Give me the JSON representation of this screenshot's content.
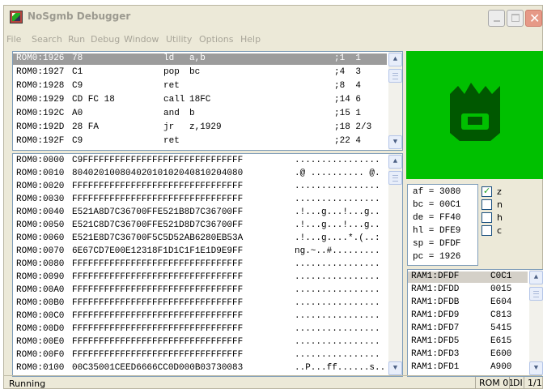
{
  "window": {
    "title": "NoSgmb Debugger"
  },
  "menu": [
    "File",
    "Search",
    "Run",
    "Debug",
    "Window",
    "Utility",
    "Options",
    "Help"
  ],
  "disassembly": [
    {
      "addr": "ROM0:1926",
      "bytes": "78",
      "op": "ld",
      "arg": "a,b",
      "cycles": ";1  1",
      "selected": true
    },
    {
      "addr": "ROM0:1927",
      "bytes": "C1",
      "op": "pop",
      "arg": "bc",
      "cycles": ";4  3"
    },
    {
      "addr": "ROM0:1928",
      "bytes": "C9",
      "op": "ret",
      "arg": "",
      "cycles": ";8  4"
    },
    {
      "addr": "ROM0:1929",
      "bytes": "CD FC 18",
      "op": "call",
      "arg": "18FC",
      "cycles": ";14 6"
    },
    {
      "addr": "ROM0:192C",
      "bytes": "A0",
      "op": "and",
      "arg": "b",
      "cycles": ";15 1"
    },
    {
      "addr": "ROM0:192D",
      "bytes": "28 FA",
      "op": "jr",
      "arg": "z,1929",
      "cycles": ";18 2/3"
    },
    {
      "addr": "ROM0:192F",
      "bytes": "C9",
      "op": "ret",
      "arg": "",
      "cycles": ";22 4"
    }
  ],
  "memory": [
    {
      "addr": "ROM0:0000",
      "hex": "C9FFFFFFFFFFFFFFFFFFFFFFFFFFFFFF",
      "ascii": "................"
    },
    {
      "addr": "ROM0:0010",
      "hex": "80402010080402010102040810204080",
      "ascii": ".@ .......... @."
    },
    {
      "addr": "ROM0:0020",
      "hex": "FFFFFFFFFFFFFFFFFFFFFFFFFFFFFFFF",
      "ascii": "................"
    },
    {
      "addr": "ROM0:0030",
      "hex": "FFFFFFFFFFFFFFFFFFFFFFFFFFFFFFFF",
      "ascii": "................"
    },
    {
      "addr": "ROM0:0040",
      "hex": "E521A8D7C36700FFE521B8D7C36700FF",
      "ascii": ".!...g...!...g.."
    },
    {
      "addr": "ROM0:0050",
      "hex": "E521C8D7C36700FFE521D8D7C36700FF",
      "ascii": ".!...g...!...g.."
    },
    {
      "addr": "ROM0:0060",
      "hex": "E521E8D7C36700F5C5D52AB6280EB53A",
      "ascii": ".!...g....*.(..:"
    },
    {
      "addr": "ROM0:0070",
      "hex": "6E67CD7E00E12318F1D1C1F1E1D9E9FF",
      "ascii": "ng.~..#........."
    },
    {
      "addr": "ROM0:0080",
      "hex": "FFFFFFFFFFFFFFFFFFFFFFFFFFFFFFFF",
      "ascii": "................"
    },
    {
      "addr": "ROM0:0090",
      "hex": "FFFFFFFFFFFFFFFFFFFFFFFFFFFFFFFF",
      "ascii": "................"
    },
    {
      "addr": "ROM0:00A0",
      "hex": "FFFFFFFFFFFFFFFFFFFFFFFFFFFFFFFF",
      "ascii": "................"
    },
    {
      "addr": "ROM0:00B0",
      "hex": "FFFFFFFFFFFFFFFFFFFFFFFFFFFFFFFF",
      "ascii": "................"
    },
    {
      "addr": "ROM0:00C0",
      "hex": "FFFFFFFFFFFFFFFFFFFFFFFFFFFFFFFF",
      "ascii": "................"
    },
    {
      "addr": "ROM0:00D0",
      "hex": "FFFFFFFFFFFFFFFFFFFFFFFFFFFFFFFF",
      "ascii": "................"
    },
    {
      "addr": "ROM0:00E0",
      "hex": "FFFFFFFFFFFFFFFFFFFFFFFFFFFFFFFF",
      "ascii": "................"
    },
    {
      "addr": "ROM0:00F0",
      "hex": "FFFFFFFFFFFFFFFFFFFFFFFFFFFFFFFF",
      "ascii": "................"
    },
    {
      "addr": "ROM0:0100",
      "hex": "00C35001CEED6666CC0D000B03730083",
      "ascii": "..P...ff......s.."
    }
  ],
  "registers": [
    {
      "text": "af = 3080"
    },
    {
      "text": "bc = 00C1"
    },
    {
      "text": "de = FF40"
    },
    {
      "text": "hl = DFE9"
    },
    {
      "text": "sp = DFDF"
    },
    {
      "text": "pc = 1926"
    }
  ],
  "flags": [
    {
      "label": "z",
      "checked": true
    },
    {
      "label": "n",
      "checked": false
    },
    {
      "label": "h",
      "checked": false
    },
    {
      "label": "c",
      "checked": false
    }
  ],
  "stack": [
    {
      "addr": "RAM1:DFDF",
      "value": "C0C1",
      "selected": true
    },
    {
      "addr": "RAM1:DFDD",
      "value": "0015"
    },
    {
      "addr": "RAM1:DFDB",
      "value": "E604"
    },
    {
      "addr": "RAM1:DFD9",
      "value": "C813"
    },
    {
      "addr": "RAM1:DFD7",
      "value": "5415"
    },
    {
      "addr": "RAM1:DFD5",
      "value": "E615"
    },
    {
      "addr": "RAM1:DFD3",
      "value": "E600"
    },
    {
      "addr": "RAM1:DFD1",
      "value": "A900"
    }
  ],
  "status": {
    "text": "Running",
    "rom": "ROM 01",
    "di": "DI",
    "page": "1/1"
  },
  "colors": {
    "screen": "#00c000",
    "glyph": "#005800",
    "selection": "#9c9c9c"
  }
}
